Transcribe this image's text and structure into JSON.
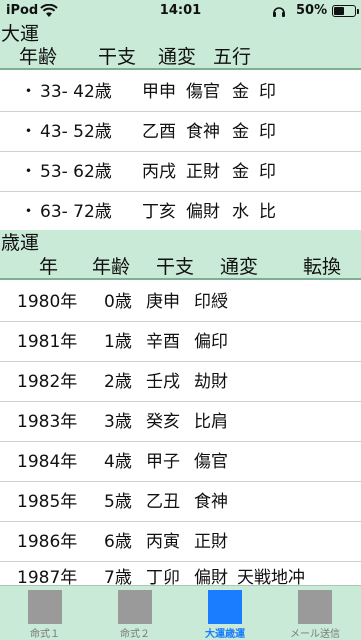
{
  "status": {
    "carrier": "iPod",
    "time": "14:01",
    "battery_text": "50%",
    "battery_level": 0.5
  },
  "taiun": {
    "title": "大運",
    "headers": [
      "年齢",
      "干支",
      "通変",
      "五行"
    ],
    "rows": [
      {
        "bullet": "・",
        "age": "33- 42歳",
        "kanshi": "甲申",
        "tsuhen": "傷官",
        "gogyo1": "金",
        "gogyo2": "印"
      },
      {
        "bullet": "・",
        "age": "43- 52歳",
        "kanshi": "乙酉",
        "tsuhen": "食神",
        "gogyo1": "金",
        "gogyo2": "印"
      },
      {
        "bullet": "・",
        "age": "53- 62歳",
        "kanshi": "丙戌",
        "tsuhen": "正財",
        "gogyo1": "金",
        "gogyo2": "印"
      },
      {
        "bullet": "・",
        "age": "63- 72歳",
        "kanshi": "丁亥",
        "tsuhen": "偏財",
        "gogyo1": "水",
        "gogyo2": "比"
      }
    ]
  },
  "saiun": {
    "title": "歳運",
    "headers": [
      "年",
      "年齢",
      "干支",
      "通変",
      "転換"
    ],
    "rows": [
      {
        "year": "1980年",
        "age": "0歳",
        "kanshi": "庚申",
        "tsuhen": "印綬",
        "tenkan": ""
      },
      {
        "year": "1981年",
        "age": "1歳",
        "kanshi": "辛酉",
        "tsuhen": "偏印",
        "tenkan": ""
      },
      {
        "year": "1982年",
        "age": "2歳",
        "kanshi": "壬戌",
        "tsuhen": "劫財",
        "tenkan": ""
      },
      {
        "year": "1983年",
        "age": "3歳",
        "kanshi": "癸亥",
        "tsuhen": "比肩",
        "tenkan": ""
      },
      {
        "year": "1984年",
        "age": "4歳",
        "kanshi": "甲子",
        "tsuhen": "傷官",
        "tenkan": ""
      },
      {
        "year": "1985年",
        "age": "5歳",
        "kanshi": "乙丑",
        "tsuhen": "食神",
        "tenkan": ""
      },
      {
        "year": "1986年",
        "age": "6歳",
        "kanshi": "丙寅",
        "tsuhen": "正財",
        "tenkan": ""
      },
      {
        "year": "1987年",
        "age": "7歳",
        "kanshi": "丁卯",
        "tsuhen": "偏財",
        "tenkan": "天戦地冲"
      }
    ]
  },
  "tabs": [
    {
      "label": "命式１",
      "icon": "meishiki1-icon",
      "active": false
    },
    {
      "label": "命式２",
      "icon": "meishiki2-icon",
      "active": false
    },
    {
      "label": "大運歳運",
      "icon": "taiun-saiun-icon",
      "active": true
    },
    {
      "label": "メール送信",
      "icon": "mail-send-icon",
      "active": false
    }
  ],
  "colors": {
    "header_bg": "#c9ead6",
    "active_tab": "#1a7cff",
    "inactive_tab": "#9a9a9a"
  }
}
